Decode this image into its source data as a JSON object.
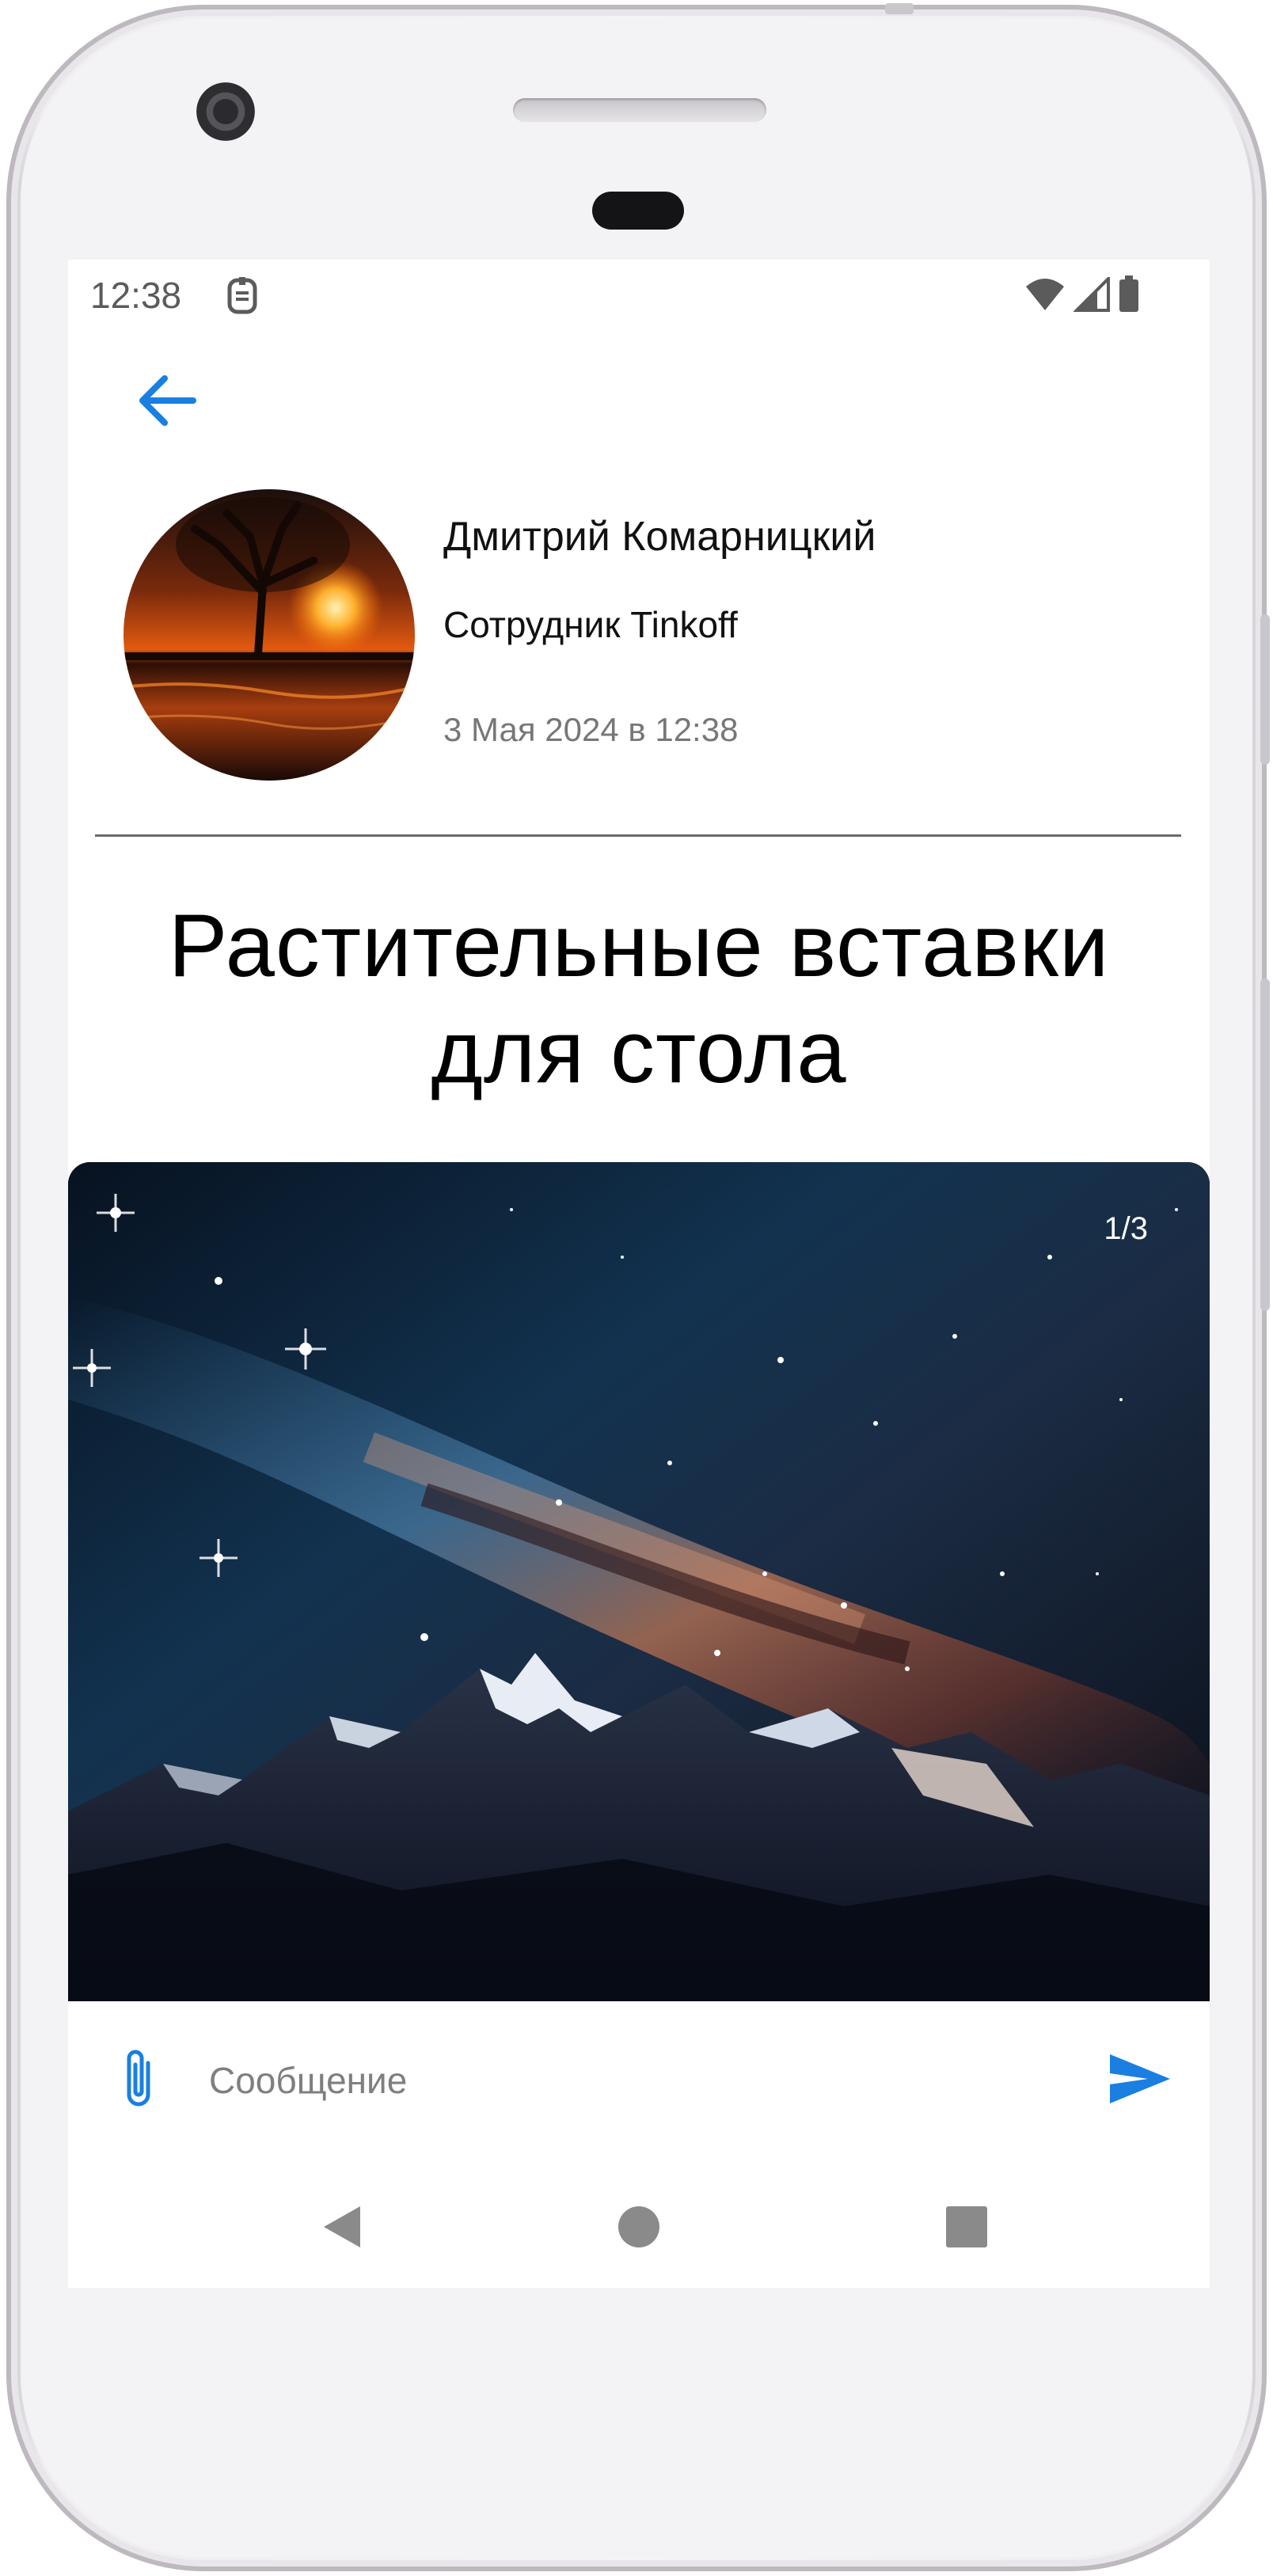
{
  "status_bar": {
    "time": "12:38",
    "icons": [
      "sim-card-icon",
      "wifi-icon",
      "cellular-signal-icon",
      "battery-icon"
    ]
  },
  "header": {
    "back_icon": "arrow-left-icon"
  },
  "author": {
    "name": "Дмитрий Комарницкий",
    "role": "Сотрудник Tinkoff",
    "date": "3 Мая 2024 в 12:38"
  },
  "post": {
    "title_line1": "Растительные вставки",
    "title_line2": "для стола"
  },
  "gallery": {
    "counter": "1/3",
    "current_image": 1,
    "total_images": 3
  },
  "composer": {
    "placeholder": "Сообщение",
    "value": "",
    "attach_icon": "paperclip-icon",
    "send_icon": "send-icon"
  },
  "nav": {
    "icons": [
      "back-triangle-icon",
      "home-circle-icon",
      "recents-square-icon"
    ]
  },
  "colors": {
    "accent": "#1a7fe0",
    "title_text": "#000000",
    "secondary_text": "#777777",
    "divider": "#6a6a6a",
    "nav_icon": "#8a8a8a"
  }
}
